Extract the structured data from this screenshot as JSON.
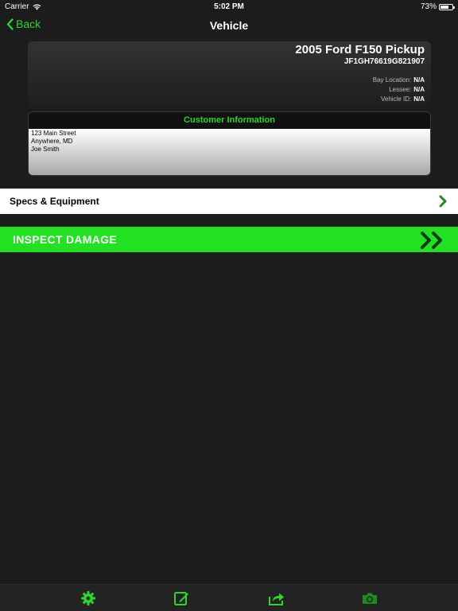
{
  "status_bar": {
    "carrier": "Carrier",
    "time": "5:02 PM",
    "battery_text": "73%",
    "battery_level": 0.73
  },
  "nav": {
    "back_label": "Back",
    "title": "Vehicle"
  },
  "vehicle": {
    "name": "2005 Ford F150 Pickup",
    "vin": "JF1GH76619G821907",
    "details": [
      {
        "label": "Bay Location:",
        "value": "N/A"
      },
      {
        "label": "Lessee:",
        "value": "N/A"
      },
      {
        "label": "Vehicle ID:",
        "value": "N/A"
      }
    ]
  },
  "customer": {
    "title": "Customer Information",
    "lines": [
      "123 Main Street",
      "Anywhere, MD",
      "Joe Smith"
    ]
  },
  "specs": {
    "label": "Specs & Equipment"
  },
  "inspect": {
    "label": "INSPECT DAMAGE"
  },
  "toolbar": {
    "icons": [
      "gear-icon",
      "edit-icon",
      "share-icon",
      "camera-icon"
    ]
  },
  "colors": {
    "accent": "#2fd52f",
    "inspect_bg": "#22e022",
    "background": "#1c1c1c"
  }
}
